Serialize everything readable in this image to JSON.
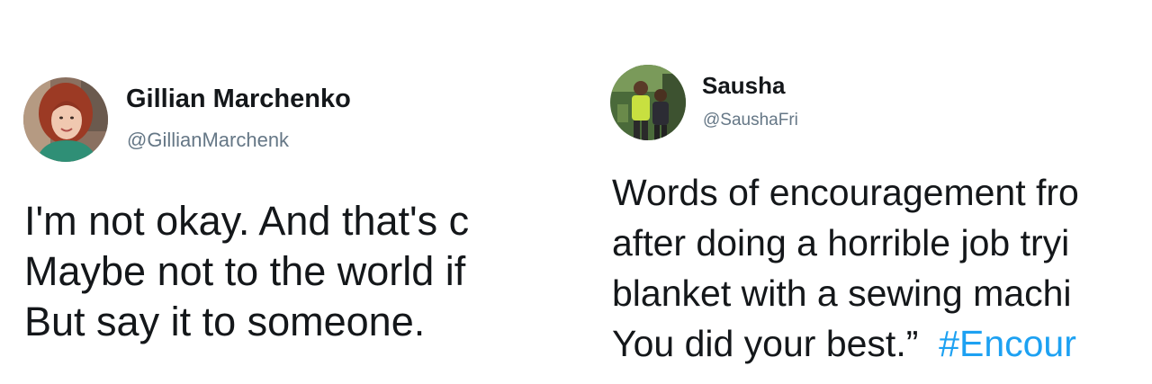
{
  "tweets": [
    {
      "display_name": "Gillian Marchenko",
      "handle": "@GillianMarchenk",
      "lines": [
        "I'm not okay. And that's c",
        "Maybe not to the world if",
        "But say it to someone."
      ]
    },
    {
      "display_name": "Sausha",
      "handle": "@SaushaFri",
      "lines": [
        "Words of encouragement fro",
        "after doing a horrible job tryi",
        "blanket with a sewing machi",
        "You did your best.”"
      ],
      "hashtag": "#Encour"
    }
  ],
  "colors": {
    "text": "#14171a",
    "handle": "#657786",
    "hashtag": "#1da1f2",
    "background": "#ffffff"
  }
}
